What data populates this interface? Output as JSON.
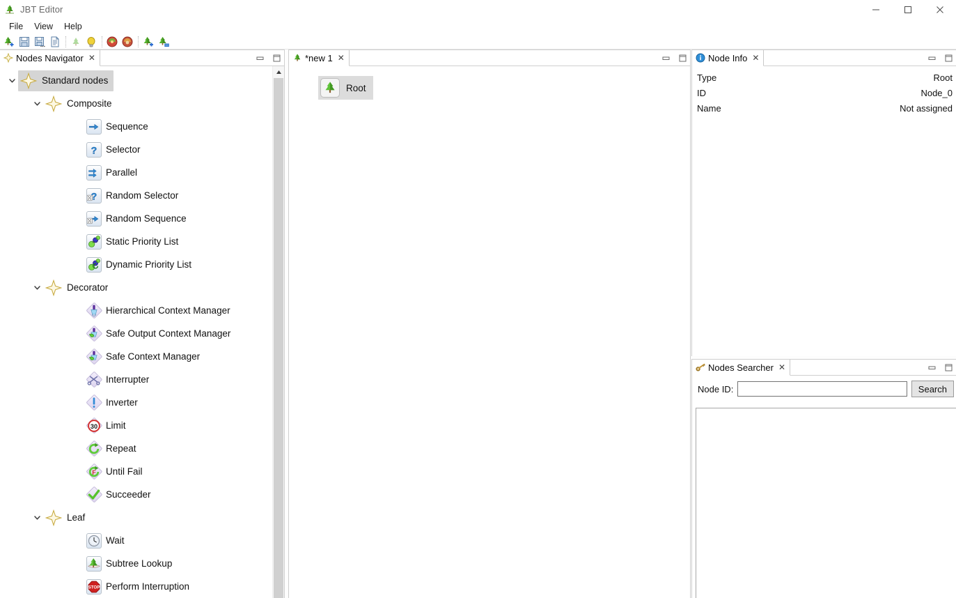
{
  "window": {
    "title": "JBT Editor",
    "app_icon": "tree-icon",
    "controls": [
      {
        "name": "minimize",
        "glyph": "minimize-icon"
      },
      {
        "name": "maximize",
        "glyph": "maximize-icon"
      },
      {
        "name": "close",
        "glyph": "close-icon"
      }
    ]
  },
  "menu": {
    "items": [
      {
        "label": "File"
      },
      {
        "label": "View"
      },
      {
        "label": "Help"
      }
    ]
  },
  "toolbar": {
    "buttons": [
      {
        "name": "new-tree-button",
        "icon": "new-tree-icon"
      },
      {
        "name": "save-button",
        "icon": "save-icon"
      },
      {
        "name": "save-as-button",
        "icon": "save-as-icon"
      },
      {
        "name": "open-file-button",
        "icon": "document-icon"
      },
      {
        "name": "tree-button",
        "icon": "tree-icon"
      },
      {
        "name": "bulb-button",
        "icon": "bulb-icon"
      },
      {
        "name": "validate-error-button",
        "icon": "error-ball-icon"
      },
      {
        "name": "validate-warning-button",
        "icon": "warning-ball-icon"
      },
      {
        "name": "add-tree-button",
        "icon": "tree-add-icon"
      },
      {
        "name": "remove-tree-button",
        "icon": "tree-remove-icon"
      }
    ]
  },
  "navigator": {
    "tab": {
      "label": "Nodes Navigator",
      "icon": "diamond-icon",
      "close": "✕"
    },
    "tools": [
      {
        "name": "minimize-view-button",
        "icon": "minimize-view-icon"
      },
      {
        "name": "maximize-view-button",
        "icon": "maximize-view-icon"
      }
    ],
    "tree": [
      {
        "label": "Standard nodes",
        "icon": "star-icon",
        "level": 0,
        "expanded": true,
        "selected": true,
        "twisty": "chevron-down-icon"
      },
      {
        "label": "Composite",
        "icon": "star-icon",
        "level": 1,
        "expanded": true,
        "selected": false,
        "twisty": "chevron-down-icon"
      },
      {
        "label": "Sequence",
        "icon": "arrow-right-icon",
        "level": 2,
        "expanded": null,
        "selected": false,
        "twisty": null
      },
      {
        "label": "Selector",
        "icon": "question-mark-icon",
        "level": 2,
        "expanded": null,
        "selected": false,
        "twisty": null
      },
      {
        "label": "Parallel",
        "icon": "double-arrow-icon",
        "level": 2,
        "expanded": null,
        "selected": false,
        "twisty": null
      },
      {
        "label": "Random Selector",
        "icon": "question-dice-icon",
        "level": 2,
        "expanded": null,
        "selected": false,
        "twisty": null
      },
      {
        "label": "Random Sequence",
        "icon": "arrow-dice-icon",
        "level": 2,
        "expanded": null,
        "selected": false,
        "twisty": null
      },
      {
        "label": "Static Priority List",
        "icon": "priority-balls-icon",
        "level": 2,
        "expanded": null,
        "selected": false,
        "twisty": null
      },
      {
        "label": "Dynamic Priority List",
        "icon": "priority-balls-dynamic-icon",
        "level": 2,
        "expanded": null,
        "selected": false,
        "twisty": null
      },
      {
        "label": "Decorator",
        "icon": "star-icon",
        "level": 1,
        "expanded": true,
        "selected": false,
        "twisty": "chevron-down-icon"
      },
      {
        "label": "Hierarchical Context Manager",
        "icon": "context-manager-icon",
        "level": 2,
        "expanded": null,
        "selected": false,
        "twisty": null
      },
      {
        "label": "Safe Output Context Manager",
        "icon": "safe-output-context-icon",
        "level": 2,
        "expanded": null,
        "selected": false,
        "twisty": null
      },
      {
        "label": "Safe Context Manager",
        "icon": "safe-context-icon",
        "level": 2,
        "expanded": null,
        "selected": false,
        "twisty": null
      },
      {
        "label": "Interrupter",
        "icon": "scissors-icon",
        "level": 2,
        "expanded": null,
        "selected": false,
        "twisty": null
      },
      {
        "label": "Inverter",
        "icon": "exclamation-icon",
        "level": 2,
        "expanded": null,
        "selected": false,
        "twisty": null
      },
      {
        "label": "Limit",
        "icon": "speed-limit-icon",
        "level": 2,
        "expanded": null,
        "selected": false,
        "twisty": null
      },
      {
        "label": "Repeat",
        "icon": "repeat-arrow-icon",
        "level": 2,
        "expanded": null,
        "selected": false,
        "twisty": null
      },
      {
        "label": "Until Fail",
        "icon": "until-fail-icon",
        "level": 2,
        "expanded": null,
        "selected": false,
        "twisty": null
      },
      {
        "label": "Succeeder",
        "icon": "check-mark-icon",
        "level": 2,
        "expanded": null,
        "selected": false,
        "twisty": null
      },
      {
        "label": "Leaf",
        "icon": "star-icon",
        "level": 1,
        "expanded": true,
        "selected": false,
        "twisty": "chevron-down-icon"
      },
      {
        "label": "Wait",
        "icon": "clock-icon",
        "level": 2,
        "expanded": null,
        "selected": false,
        "twisty": null
      },
      {
        "label": "Subtree Lookup",
        "icon": "subtree-lookup-icon",
        "level": 2,
        "expanded": null,
        "selected": false,
        "twisty": null
      },
      {
        "label": "Perform Interruption",
        "icon": "stop-sign-icon",
        "level": 2,
        "expanded": null,
        "selected": false,
        "twisty": null
      }
    ],
    "scrollbar": {
      "up_arrow": "scroll-up-icon"
    }
  },
  "editor": {
    "tab": {
      "label": "*new 1",
      "icon": "tree-icon",
      "close": "✕"
    },
    "tools": [
      {
        "name": "minimize-view-button",
        "icon": "minimize-view-icon"
      },
      {
        "name": "maximize-view-button",
        "icon": "maximize-view-icon"
      }
    ],
    "nodes": [
      {
        "label": "Root",
        "icon": "tree-icon",
        "selected": true
      }
    ]
  },
  "node_info": {
    "tab": {
      "label": "Node Info",
      "icon": "info-icon",
      "close": "✕"
    },
    "tools": [
      {
        "name": "minimize-view-button",
        "icon": "minimize-view-icon"
      },
      {
        "name": "maximize-view-button",
        "icon": "maximize-view-icon"
      }
    ],
    "rows": [
      {
        "key": "Type",
        "value": "Root"
      },
      {
        "key": "ID",
        "value": "Node_0"
      },
      {
        "key": "Name",
        "value": "Not assigned"
      }
    ]
  },
  "nodes_searcher": {
    "tab": {
      "label": "Nodes Searcher",
      "icon": "key-icon",
      "close": "✕"
    },
    "tools": [
      {
        "name": "minimize-view-button",
        "icon": "minimize-view-icon"
      },
      {
        "name": "maximize-view-button",
        "icon": "maximize-view-icon"
      }
    ],
    "field_label": "Node ID:",
    "field_value": "",
    "field_placeholder": "",
    "search_button": "Search",
    "results": []
  },
  "colors": {
    "selection": "#d5d5d5",
    "panel_border": "#cfcfcf",
    "tree_green": "#4caf2f",
    "arrow_blue": "#2f7fd0",
    "star_gold": "#e8d57a",
    "stop_red": "#cc1f1f"
  }
}
